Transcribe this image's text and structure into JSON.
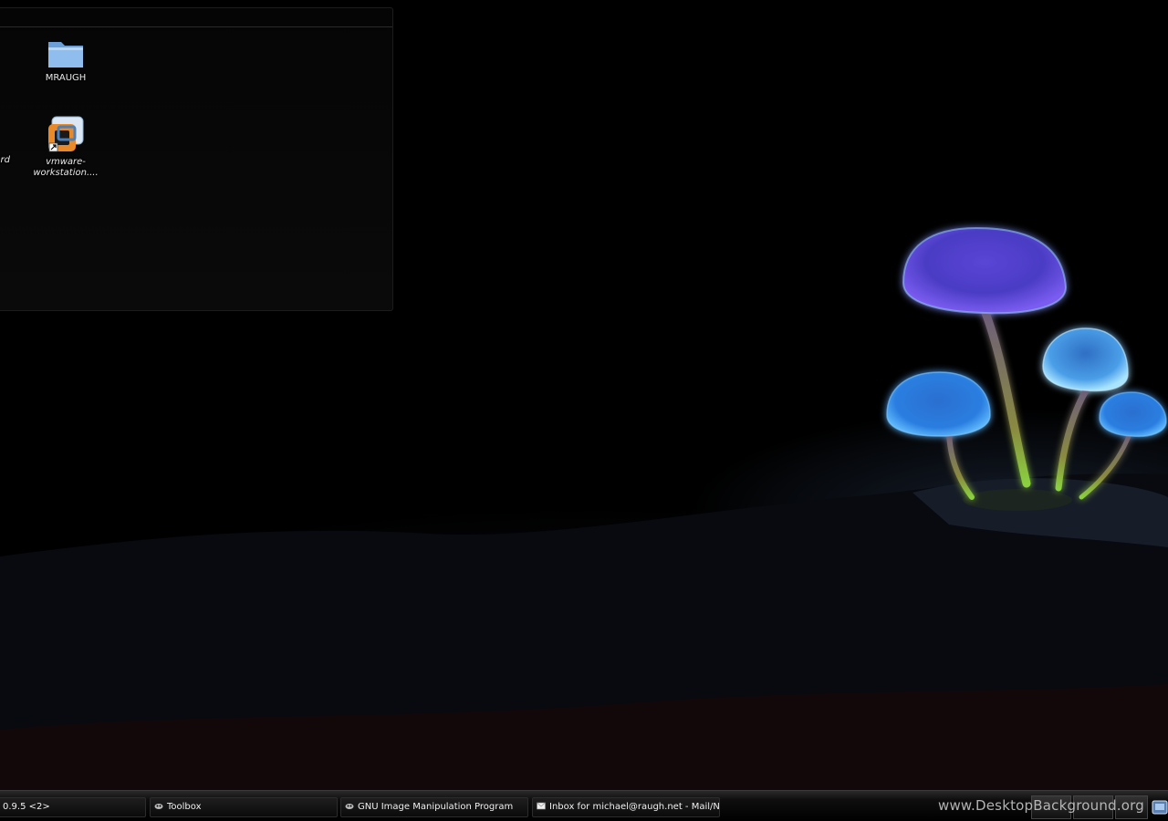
{
  "desktop": {
    "icons": [
      {
        "label": "MRAUGH"
      },
      {
        "label": "vmware-\nworkstation...."
      },
      {
        "label": "rd"
      }
    ]
  },
  "taskbar": {
    "items": [
      {
        "label": "0.9.5 <2>"
      },
      {
        "label": "Toolbox"
      },
      {
        "label": "GNU Image Manipulation Program"
      },
      {
        "label": "Inbox for michael@raugh.net - Mail/Ne"
      }
    ]
  },
  "watermark": "www.DesktopBackground.org",
  "colors": {
    "mushroom_purple": "#7a5cf0",
    "mushroom_blue": "#3a8fe8",
    "folder_blue": "#7ab0ea",
    "vmware_orange": "#e88a2a"
  },
  "icons": [
    "folder-icon",
    "vmware-icon",
    "taskbar-app-icon",
    "mail-icon",
    "tray-icon"
  ]
}
